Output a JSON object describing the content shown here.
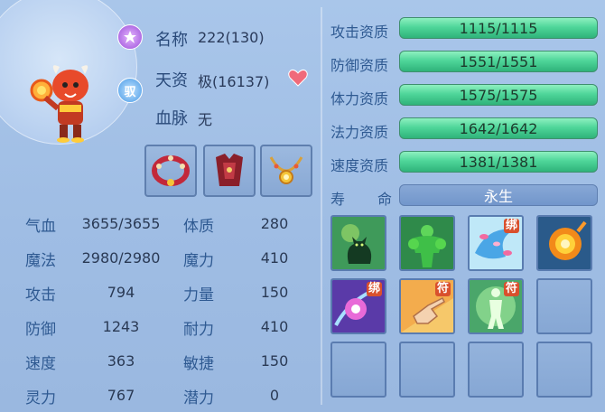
{
  "pet": {
    "name_label": "名称",
    "name_value": "222(130)",
    "talent_label": "天资",
    "talent_value": "极(16137)",
    "bloodline_label": "血脉",
    "bloodline_value": "无",
    "badge_top_icon": "purple-emblem-icon",
    "badge_mid_text": "驭"
  },
  "stats": [
    {
      "label": "气血",
      "value": "3655/3655"
    },
    {
      "label": "魔法",
      "value": "2980/2980"
    },
    {
      "label": "攻击",
      "value": "794"
    },
    {
      "label": "防御",
      "value": "1243"
    },
    {
      "label": "速度",
      "value": "363"
    },
    {
      "label": "灵力",
      "value": "767"
    }
  ],
  "attributes": [
    {
      "label": "体质",
      "value": "280"
    },
    {
      "label": "魔力",
      "value": "410"
    },
    {
      "label": "力量",
      "value": "150"
    },
    {
      "label": "耐力",
      "value": "410"
    },
    {
      "label": "敏捷",
      "value": "150"
    },
    {
      "label": "潜力",
      "value": "0"
    }
  ],
  "equipment": [
    "collar-icon",
    "armor-icon",
    "necklace-icon"
  ],
  "qualifications": [
    {
      "label": "攻击资质",
      "value": "1115/1115"
    },
    {
      "label": "防御资质",
      "value": "1551/1551"
    },
    {
      "label": "体力资质",
      "value": "1575/1575"
    },
    {
      "label": "法力资质",
      "value": "1642/1642"
    },
    {
      "label": "速度资质",
      "value": "1381/1381"
    }
  ],
  "lifespan": {
    "label_a": "寿",
    "label_b": "命",
    "value": "永生"
  },
  "skills": [
    {
      "icon": "cat-silhouette-icon",
      "tag": ""
    },
    {
      "icon": "green-muscle-icon",
      "tag": ""
    },
    {
      "icon": "petal-swirl-icon",
      "tag": "绑"
    },
    {
      "icon": "fireball-icon",
      "tag": ""
    },
    {
      "icon": "purple-orb-icon",
      "tag": "绑"
    },
    {
      "icon": "pointing-hand-icon",
      "tag": "符"
    },
    {
      "icon": "glowing-figure-icon",
      "tag": "符"
    },
    {
      "icon": "empty-slot",
      "tag": ""
    },
    {
      "icon": "empty-slot",
      "tag": ""
    },
    {
      "icon": "empty-slot",
      "tag": ""
    },
    {
      "icon": "empty-slot",
      "tag": ""
    },
    {
      "icon": "empty-slot",
      "tag": ""
    }
  ],
  "colors": {
    "bar_green": "#4fd69a",
    "label_blue": "#2f5a92",
    "tag_red": "#d9502d"
  }
}
